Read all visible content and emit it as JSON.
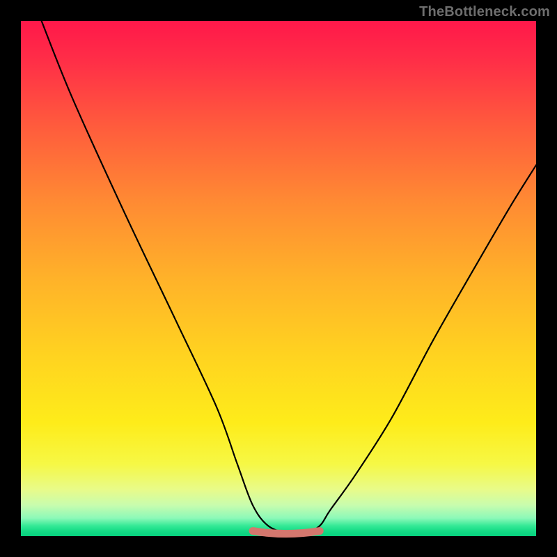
{
  "watermark": "TheBottleneck.com",
  "chart_data": {
    "type": "line",
    "title": "",
    "xlabel": "",
    "ylabel": "",
    "xlim": [
      0,
      100
    ],
    "ylim": [
      0,
      100
    ],
    "series": [
      {
        "name": "curve",
        "x": [
          4,
          10,
          20,
          30,
          38,
          42,
          45,
          48,
          52,
          55,
          58,
          60,
          65,
          72,
          80,
          88,
          95,
          100
        ],
        "values": [
          100,
          85,
          63,
          42,
          25,
          14,
          6,
          2,
          0.5,
          0.5,
          2,
          5,
          12,
          23,
          38,
          52,
          64,
          72
        ]
      }
    ],
    "trough": {
      "x_start": 45,
      "x_end": 58,
      "y": 1,
      "color": "#d4776e"
    }
  }
}
